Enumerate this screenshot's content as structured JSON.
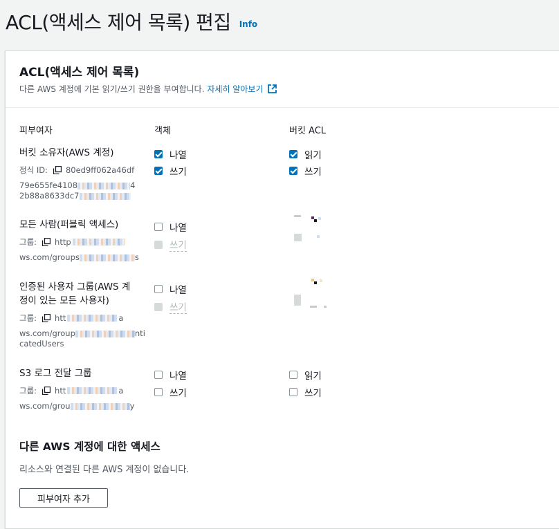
{
  "header": {
    "title": "ACL(액세스 제어 목록) 편집",
    "info": "Info"
  },
  "panel": {
    "title": "ACL(액세스 제어 목록)",
    "description": "다른 AWS 계정에 기본 읽기/쓰기 권한을 부여합니다.",
    "learn_more": "자세히 알아보기"
  },
  "columns": {
    "grantee": "피부여자",
    "object": "객체",
    "bucket_acl": "버킷 ACL"
  },
  "grantees": [
    {
      "label": "버킷 소유자(AWS 계정)",
      "meta_label": "정식 ID:",
      "meta_value": "80ed9ff062a46df",
      "line2": "79e655fe4108",
      "line2_tail": "4",
      "line3": "2b88a8633dc7",
      "object_list": "나열",
      "object_write": "쓰기",
      "acl_read": "읽기",
      "acl_write": "쓰기"
    },
    {
      "label": "모든 사람(퍼블릭 액세스)",
      "meta_label": "그룹:",
      "meta_value": "http",
      "line2": "ws.com/groups",
      "line2_tail": "s",
      "object_list": "나열",
      "object_write": "쓰기"
    },
    {
      "label_line1": "인증된 사용자 그룹(AWS 계",
      "label_line2": "정이 있는 모든 사용자)",
      "meta_label": "그룹:",
      "meta_value": "htt",
      "meta_tail": "a",
      "line2": "ws.com/group",
      "line2_tail": "nti",
      "line3": "catedUsers",
      "object_list": "나열",
      "object_write": "쓰기"
    },
    {
      "label": "S3 로그 전달 그룹",
      "meta_label": "그룹:",
      "meta_value": "htt",
      "meta_tail": "a",
      "line2": "ws.com/grou",
      "line2_tail": "y",
      "object_list": "나열",
      "object_write": "쓰기",
      "acl_read": "읽기",
      "acl_write": "쓰기"
    }
  ],
  "other_accounts": {
    "title": "다른 AWS 계정에 대한 액세스",
    "description": "리소스와 연결된 다른 AWS 계정이 없습니다.",
    "add_button": "피부여자 추가"
  },
  "colors": {
    "accent": "#0073bb",
    "text": "#16191f",
    "muted": "#545b64"
  }
}
